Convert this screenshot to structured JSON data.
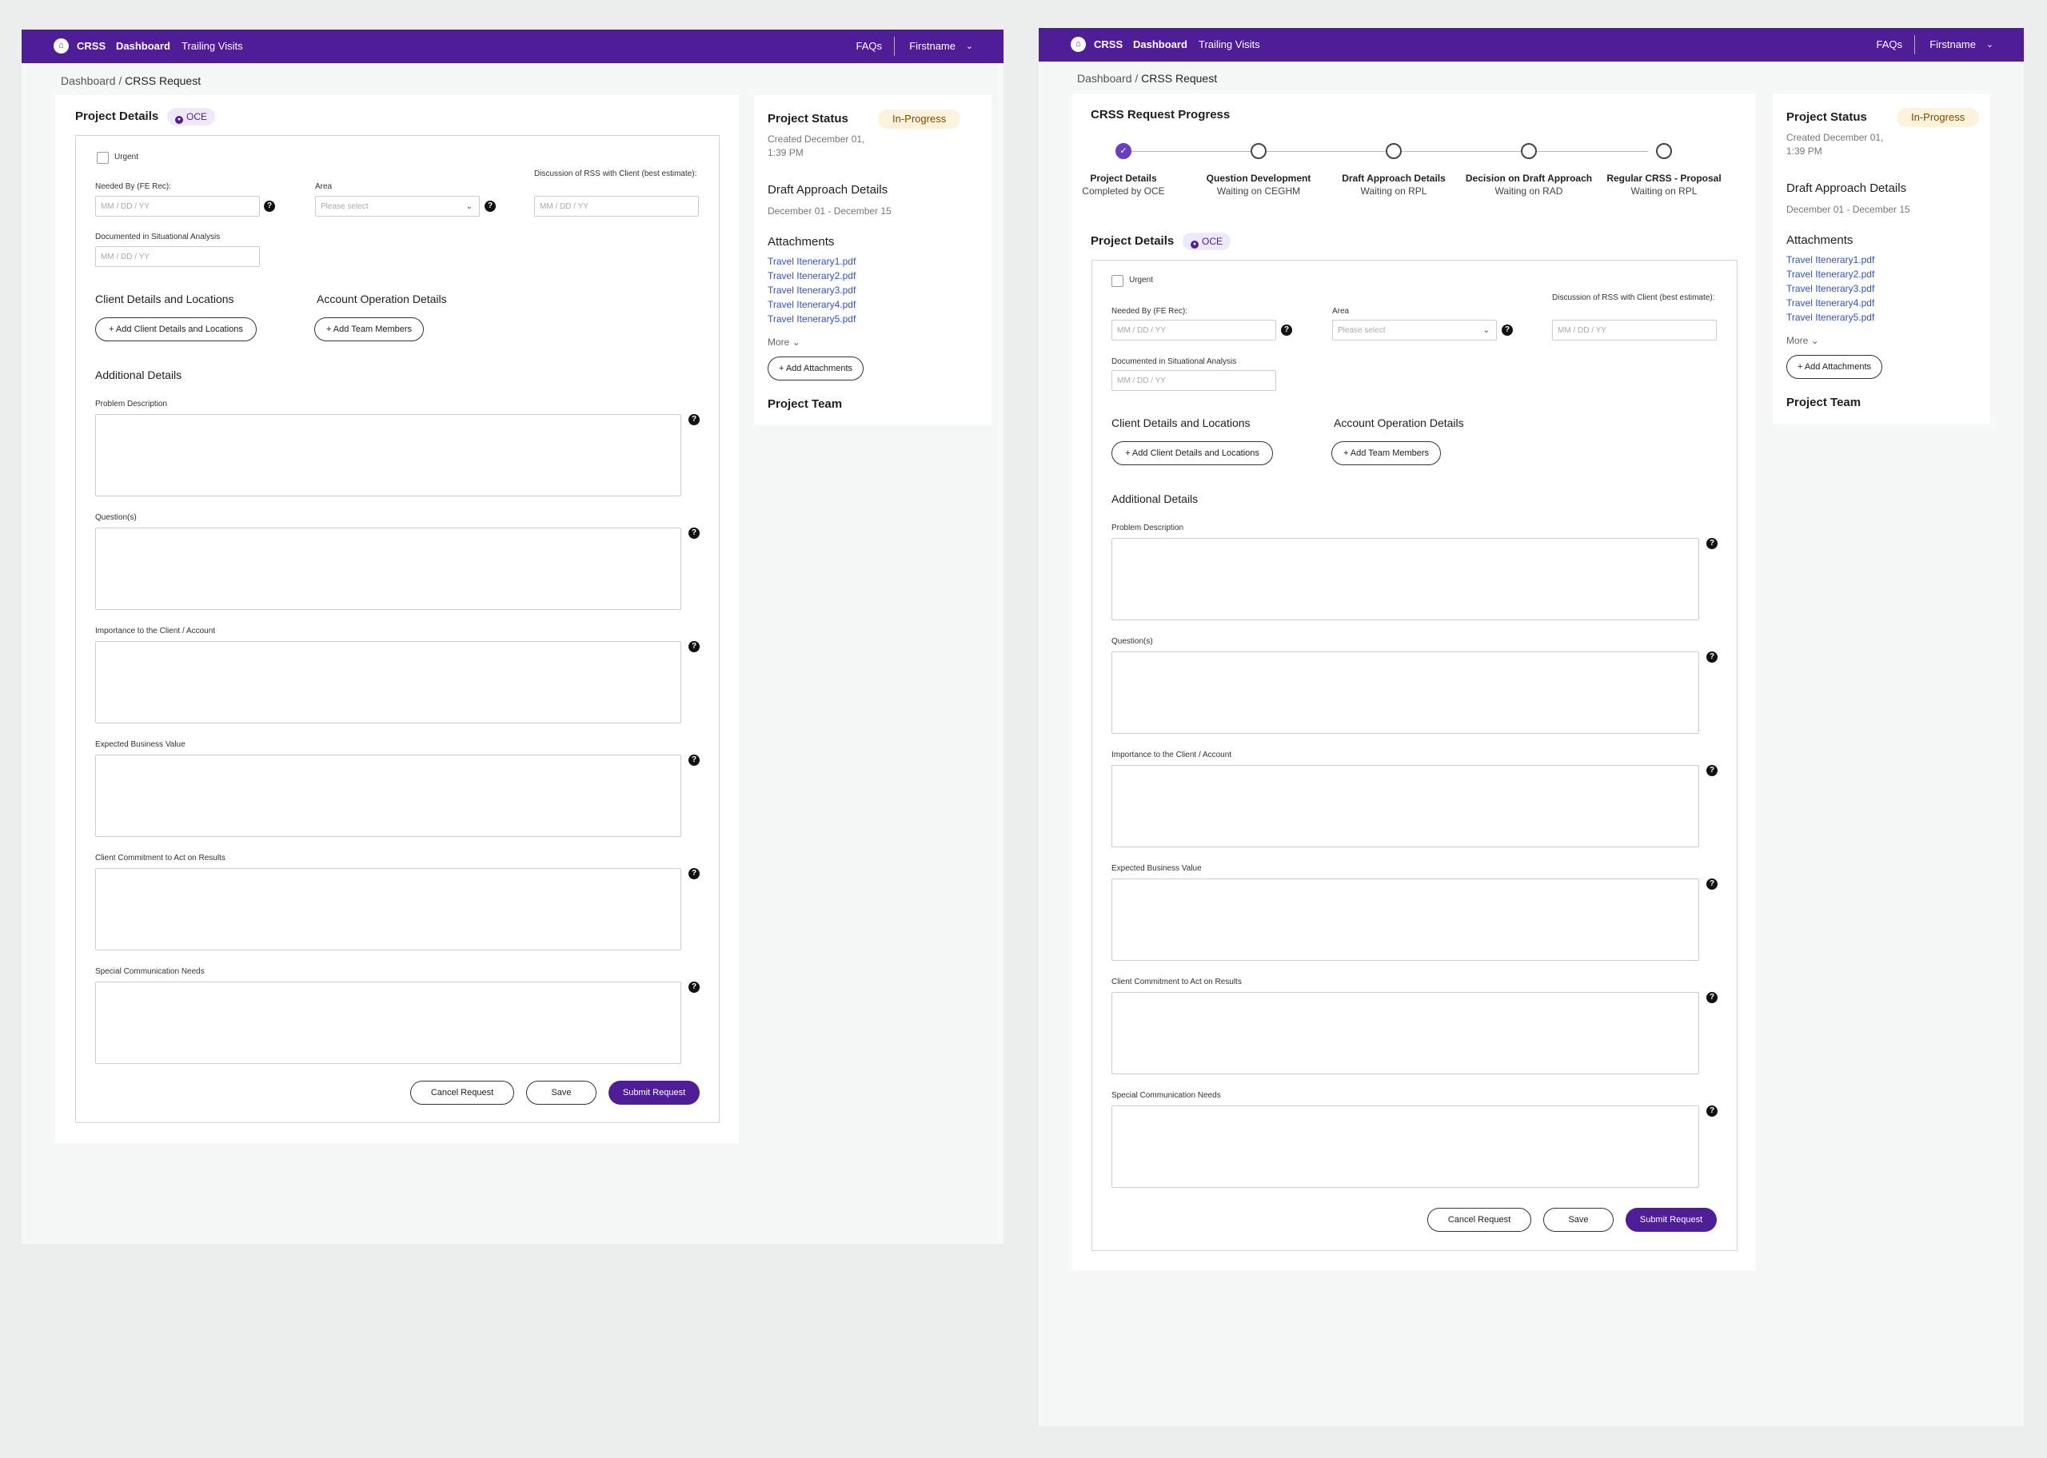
{
  "topbar": {
    "app_name": "CRSS",
    "nav_dashboard": "Dashboard",
    "nav_trailing": "Trailing Visits",
    "faq": "FAQs",
    "user": "Firstname"
  },
  "breadcrumb": {
    "parent": "Dashboard",
    "separator": " / ",
    "current": "CRSS Request"
  },
  "progress": {
    "title": "CRSS Request Progress",
    "steps": [
      {
        "label": "Project Details",
        "status": "Completed by OCE"
      },
      {
        "label": "Question Development",
        "status": "Waiting on CEGHM"
      },
      {
        "label": "Draft Approach Details",
        "status": "Waiting on RPL"
      },
      {
        "label": "Decision on Draft Approach",
        "status": "Waiting on RAD"
      },
      {
        "label": "Regular CRSS - Proposal",
        "status": "Waiting on RPL"
      }
    ]
  },
  "form": {
    "title": "Project Details",
    "badge": "OCE",
    "urgent": "Urgent",
    "needed_by_label": "Needed By (FE Rec):",
    "area_label": "Area",
    "discussion_label": "Discussion of RSS with Client (best estimate):",
    "documented_label": "Documented in Situational Analysis",
    "date_placeholder": "MM / DD / YY",
    "select_placeholder": "Please select",
    "client_title": "Client Details and Locations",
    "account_title": "Account Operation Details",
    "add_client_btn": "+ Add Client Details and Locations",
    "add_team_btn": "+ Add Team Members",
    "additional_title": "Additional Details",
    "fields": [
      "Problem Description",
      "Question(s)",
      "Importance to the Client / Account",
      "Expected Business Value",
      "Client Commitment to Act on Results",
      "Special Communication Needs"
    ],
    "cancel_btn": "Cancel Request",
    "save_btn": "Save",
    "submit_btn": "Submit Request"
  },
  "sidebar": {
    "status_title": "Project Status",
    "status": "In-Progress",
    "created": "Created December 01, 1:39 PM",
    "draft_title": "Draft Approach Details",
    "draft_dates": "December 01 - December 15",
    "attachments_title": "Attachments",
    "attachments": [
      "Travel Itenerary1.pdf",
      "Travel Itenerary2.pdf",
      "Travel Itenerary3.pdf",
      "Travel Itenerary4.pdf",
      "Travel Itenerary5.pdf"
    ],
    "more": "More",
    "add_attachments_btn": "+ Add Attachments",
    "team_title": "Project Team"
  },
  "colors": {
    "brand": "#4f1e96",
    "link": "#3350c8",
    "status_bg": "#fdf3dc"
  }
}
